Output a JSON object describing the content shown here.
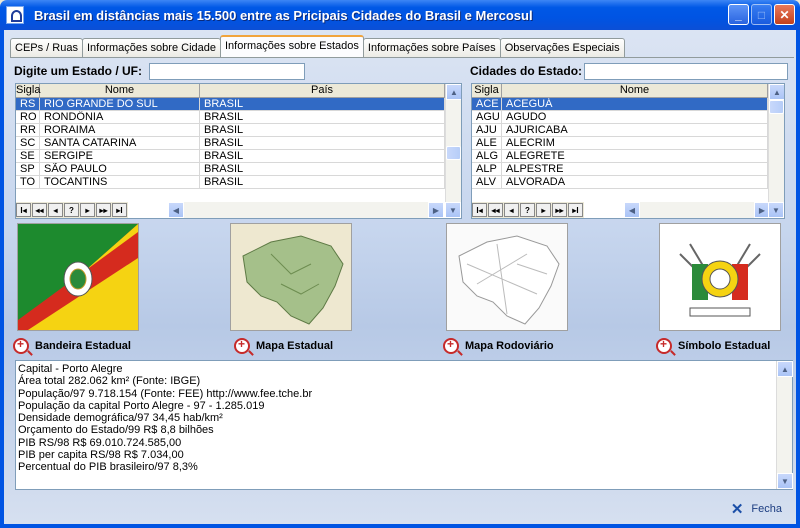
{
  "window": {
    "title": "Brasil em  distâncias mais 15.500 entre as Pricipais Cidades do Brasil e Mercosul"
  },
  "tabs": [
    {
      "label": "CEPs / Ruas"
    },
    {
      "label": "Informações sobre Cidade"
    },
    {
      "label": "Informações sobre Estados",
      "active": true
    },
    {
      "label": "Informações sobre Países"
    },
    {
      "label": "Observações Especiais"
    }
  ],
  "estado": {
    "label": "Digite um Estado / UF:",
    "value": "",
    "columns": [
      "Sigla",
      "Nome",
      "País"
    ],
    "rows": [
      [
        "RS",
        "RIO GRANDE DO SUL",
        "BRASIL"
      ],
      [
        "RO",
        "RONDÔNIA",
        "BRASIL"
      ],
      [
        "RR",
        "RORAIMA",
        "BRASIL"
      ],
      [
        "SC",
        "SANTA CATARINA",
        "BRASIL"
      ],
      [
        "SE",
        "SERGIPE",
        "BRASIL"
      ],
      [
        "SP",
        "SÃO PAULO",
        "BRASIL"
      ],
      [
        "TO",
        "TOCANTINS",
        "BRASIL"
      ]
    ],
    "selected_row": 0
  },
  "cidades": {
    "label": "Cidades do Estado:",
    "value": "",
    "columns": [
      "Sigla",
      "Nome"
    ],
    "rows": [
      [
        "ACE",
        "ACEGUÁ"
      ],
      [
        "AGU",
        "AGUDO"
      ],
      [
        "AJU",
        "AJURICABA"
      ],
      [
        "ALE",
        "ALECRIM"
      ],
      [
        "ALG",
        "ALEGRETE"
      ],
      [
        "ALP",
        "ALPESTRE"
      ],
      [
        "ALV",
        "ALVORADA"
      ]
    ],
    "selected_row": 0
  },
  "navigator": [
    "I◂",
    "◂◂",
    "◂",
    "?",
    "▸",
    "▸▸",
    "▸I"
  ],
  "images": [
    {
      "caption": "Bandeira Estadual",
      "icon": "flag-rs-image"
    },
    {
      "caption": "Mapa Estadual",
      "icon": "state-map-image"
    },
    {
      "caption": "Mapa Rodoviário",
      "icon": "road-map-image"
    },
    {
      "caption": "Símbolo Estadual",
      "icon": "coat-of-arms-image"
    }
  ],
  "info_lines": [
    "Capital - Porto Alegre",
    "Área total  282.062 km² (Fonte: IBGE)",
    "População/97  9.718.154 (Fonte: FEE)  http://www.fee.tche.br",
    "População da capital Porto Alegre - 97 -  1.285.019",
    "Densidade demográfica/97  34,45 hab/km²",
    "Orçamento do Estado/99  R$ 8,8 bilhões",
    "PIB RS/98  R$ 69.010.724.585,00",
    "PIB per capita RS/98  R$ 7.034,00",
    "Percentual do PIB brasileiro/97  8,3%"
  ],
  "close_label": "Fecha",
  "colors": {
    "titlebar": "#0054e3",
    "selection": "#316ac5",
    "flag_green": "#1d8a2e",
    "flag_red": "#d52b1e",
    "flag_yellow": "#f5d312"
  }
}
